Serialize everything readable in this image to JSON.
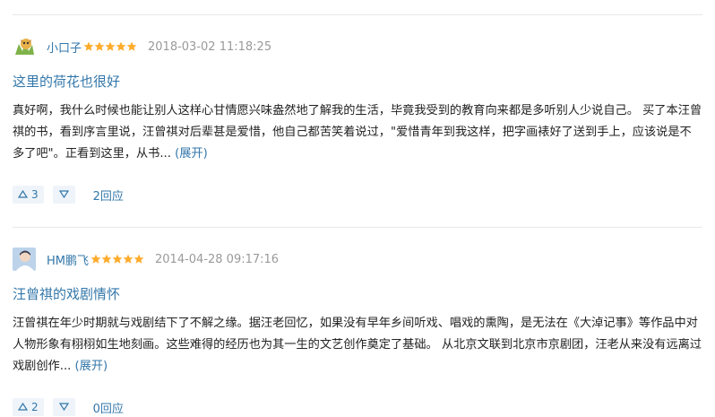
{
  "reviews": [
    {
      "user": "小口子",
      "time": "2018-03-02 11:18:25",
      "title": "这里的荷花也很好",
      "body": "真好啊，我什么时候也能让别人这样心甘情愿兴味盎然地了解我的生活，毕竟我受到的教育向来都是多听别人少说自己。 买了本汪曾祺的书，看到序言里说，汪曾祺对后辈甚是爱惜，他自己都苦笑着说过，\"爱惜青年到我这样，把字画裱好了送到手上，应该说是不多了吧\"。正看到这里，从书...",
      "expand": "(展开)",
      "up": "3",
      "replies": "2回应",
      "rating": 5
    },
    {
      "user": "HM鹏飞",
      "time": "2014-04-28 09:17:16",
      "title": "汪曾祺的戏剧情怀",
      "body": "汪曾祺在年少时期就与戏剧结下了不解之缘。据汪老回忆，如果没有早年乡间听戏、唱戏的熏陶，是无法在《大淖记事》等作品中对人物形象有栩栩如生地刻画。这些难得的经历也为其一生的文艺创作奠定了基础。 从北京文联到北京市京剧团，汪老从来没有远离过戏剧创作...",
      "expand": "(展开)",
      "up": "2",
      "replies": "0回应",
      "rating": 5
    }
  ],
  "colors": {
    "link": "#3377aa",
    "star": "#ffac2d",
    "meta": "#9a9a9a",
    "vote_bg": "#eef4f9"
  },
  "icons": {
    "up": "triangle-up-icon",
    "down": "triangle-down-icon",
    "star": "star-icon"
  }
}
